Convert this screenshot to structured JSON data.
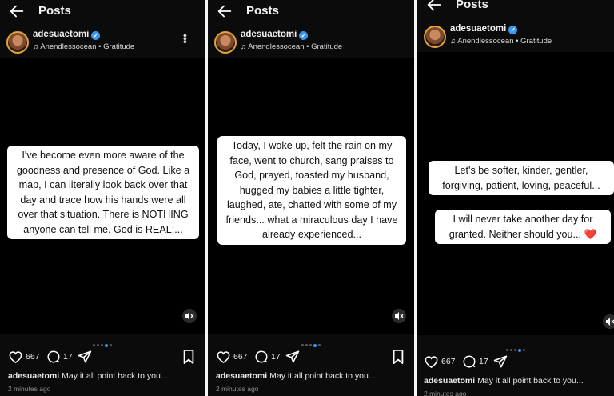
{
  "header": {
    "title": "Posts"
  },
  "user": {
    "username": "adesuaetomi",
    "music": "Anendlessocean • Gratitude"
  },
  "post": {
    "likes": "667",
    "comments": "17",
    "caption_user": "adesuaetomi",
    "caption_text": "May it all point back to you...",
    "time": "2 minutes ago"
  },
  "panels": [
    {
      "texts": [
        "I've become even more aware of the goodness and presence of God. Like a map, I can literally look back over that day and trace how his hands were all over that situation. There is NOTHING anyone can tell me. God is REAL!..."
      ]
    },
    {
      "texts": [
        "Today, I woke up, felt the rain on my face, went to church, sang praises to God, prayed, toasted my husband, hugged my babies a little tighter, laughed, ate, chatted with some of my friends... what a miraculous day I have already experienced..."
      ]
    },
    {
      "texts": [
        "Let's be softer, kinder, gentler, forgiving, patient, loving, peaceful...",
        "I will never take another day for granted. Neither should you... ❤️"
      ]
    }
  ],
  "colors": {
    "accent": "#3897f0",
    "background": "#000000",
    "heart": "#e02020"
  },
  "icons": [
    "back-arrow-icon",
    "music-note-icon",
    "more-icon",
    "mute-icon",
    "heart-icon",
    "comment-icon",
    "share-icon",
    "bookmark-icon",
    "verified-icon"
  ]
}
